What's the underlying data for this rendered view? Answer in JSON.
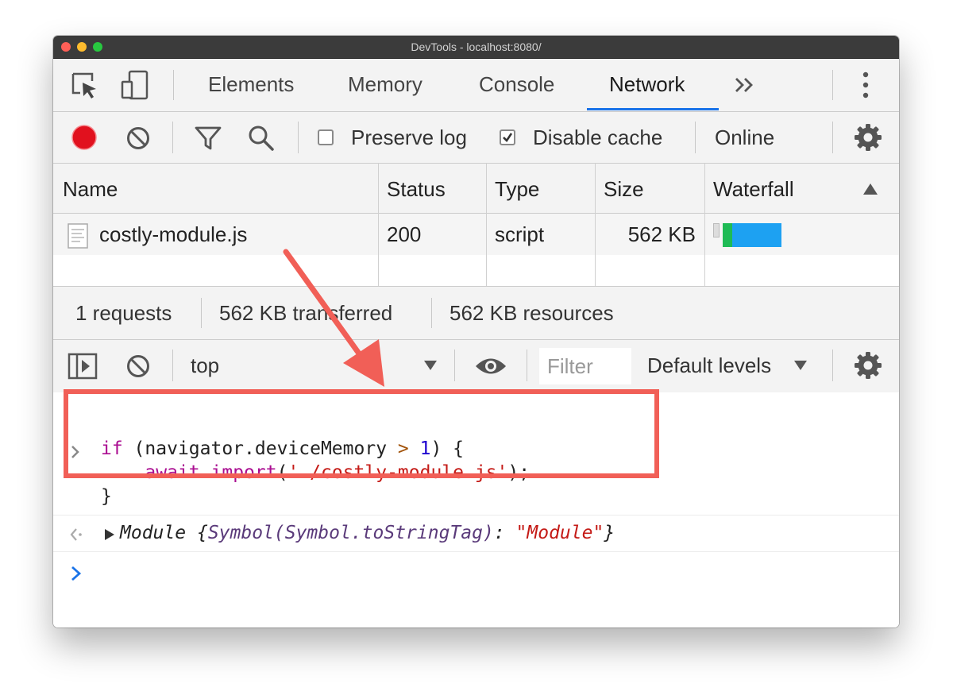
{
  "window": {
    "title": "DevTools - localhost:8080/"
  },
  "tabs": [
    {
      "label": "Elements"
    },
    {
      "label": "Memory"
    },
    {
      "label": "Console"
    },
    {
      "label": "Network",
      "active": true
    }
  ],
  "toolbar": {
    "preserve_log_label": "Preserve log",
    "preserve_log_checked": false,
    "disable_cache_label": "Disable cache",
    "disable_cache_checked": true,
    "throttling_value": "Online"
  },
  "network_table": {
    "columns": [
      "Name",
      "Status",
      "Type",
      "Size",
      "Waterfall"
    ],
    "rows": [
      {
        "name": "costly-module.js",
        "status": "200",
        "type": "script",
        "size": "562 KB"
      }
    ]
  },
  "summary": {
    "requests": "1 requests",
    "transferred": "562 KB transferred",
    "resources": "562 KB resources"
  },
  "console_toolbar": {
    "context": "top",
    "filter_placeholder": "Filter",
    "levels": "Default levels"
  },
  "console": {
    "input_tokens": {
      "if": "if",
      "cond_open": " (navigator.deviceMemory ",
      "gt": ">",
      "space": " ",
      "one": "1",
      "cond_close": ") {",
      "indent": "    ",
      "await": "await",
      "import": "import",
      "paren_open": "(",
      "path": "'./costly-module.js'",
      "paren_close": ");",
      "brace_close": "}"
    },
    "result": {
      "type": "Module",
      "brace_open": "{",
      "key": "Symbol(Symbol.toStringTag)",
      "colon": ": ",
      "value": "\"Module\"",
      "brace_close": "}"
    }
  },
  "colors": {
    "accent": "#1a73e8",
    "record": "#e1111e",
    "highlight_border": "#f15f57",
    "keyword": "#aa0d91",
    "number": "#1c00cf",
    "string": "#c41a16"
  }
}
